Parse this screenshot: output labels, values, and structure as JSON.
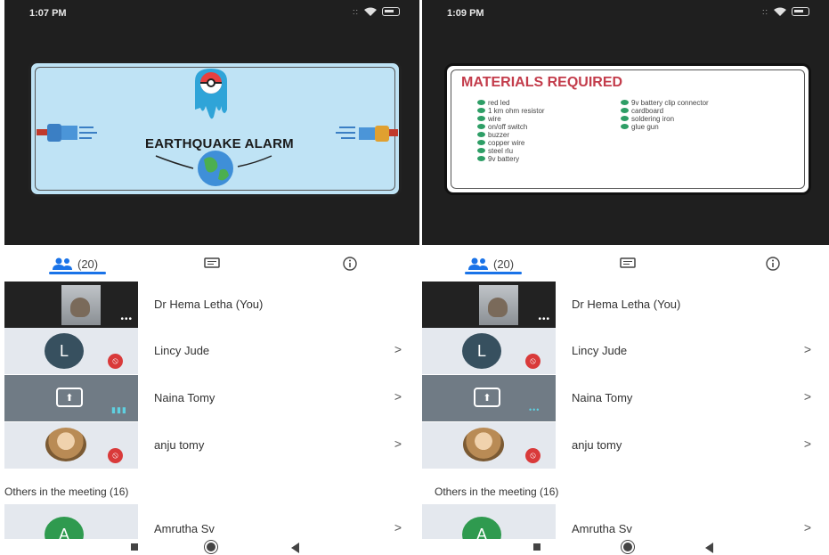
{
  "left": {
    "status_time": "1:07 PM",
    "slide_title": "EARTHQUAKE ALARM",
    "tabs": {
      "people_count": "(20)"
    },
    "participants": [
      {
        "name": "Dr Hema Letha (You)"
      },
      {
        "name": "Lincy Jude",
        "initial": "L"
      },
      {
        "name": "Naina Tomy"
      },
      {
        "name": "anju tomy"
      }
    ],
    "others_header": "Others in the meeting (16)",
    "others": [
      {
        "name": "Amrutha Sv",
        "initial": "A"
      }
    ]
  },
  "right": {
    "status_time": "1:09 PM",
    "slide_title": "MATERIALS REQUIRED",
    "materials_col1": [
      "red led",
      "1 km ohm resistor",
      "wire",
      "on/off switch",
      "buzzer",
      "copper wire",
      "steel rlu",
      "9v battery"
    ],
    "materials_col2": [
      "9v battery clip connector",
      "cardboard",
      "soldering iron",
      "glue gun"
    ],
    "tabs": {
      "people_count": "(20)"
    },
    "participants": [
      {
        "name": "Dr Hema Letha (You)"
      },
      {
        "name": "Lincy Jude",
        "initial": "L"
      },
      {
        "name": "Naina Tomy"
      },
      {
        "name": "anju tomy"
      }
    ],
    "others_header": "Others in the meeting (16)",
    "others": [
      {
        "name": "Amrutha Sv",
        "initial": "A"
      }
    ]
  },
  "chevron": ">",
  "colors": {
    "accent": "#1a73e8",
    "mute": "#d93a3a",
    "materials_title": "#c33c4b"
  }
}
